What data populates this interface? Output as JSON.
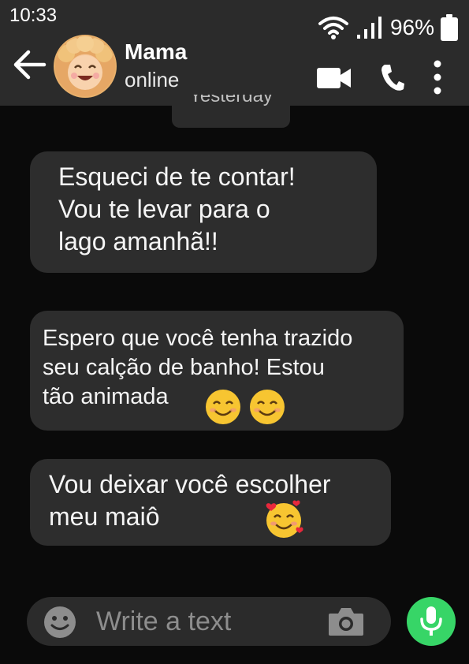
{
  "status_bar": {
    "time": "10:33",
    "battery": "96%"
  },
  "header": {
    "contact_name": "Mama",
    "contact_status": "online"
  },
  "date_divider": "Yesterday",
  "messages": [
    {
      "lines": [
        "Esqueci de te contar!",
        "Vou te levar para o",
        "lago amanhã!!"
      ]
    },
    {
      "lines": [
        "Espero que você tenha trazido",
        "seu calção de banho! Estou",
        "tão animada"
      ],
      "emojis": [
        "smiling-face-icon",
        "smiling-face-icon"
      ]
    },
    {
      "lines": [
        "Vou deixar você escolher",
        "meu maiô"
      ],
      "emojis": [
        "smiling-face-with-hearts-icon"
      ]
    }
  ],
  "composer": {
    "placeholder": "Write a text"
  },
  "colors": {
    "background": "#0a0a0a",
    "header": "#2b2b2b",
    "bubble": "#2d2d2d",
    "mic": "#37d567"
  }
}
